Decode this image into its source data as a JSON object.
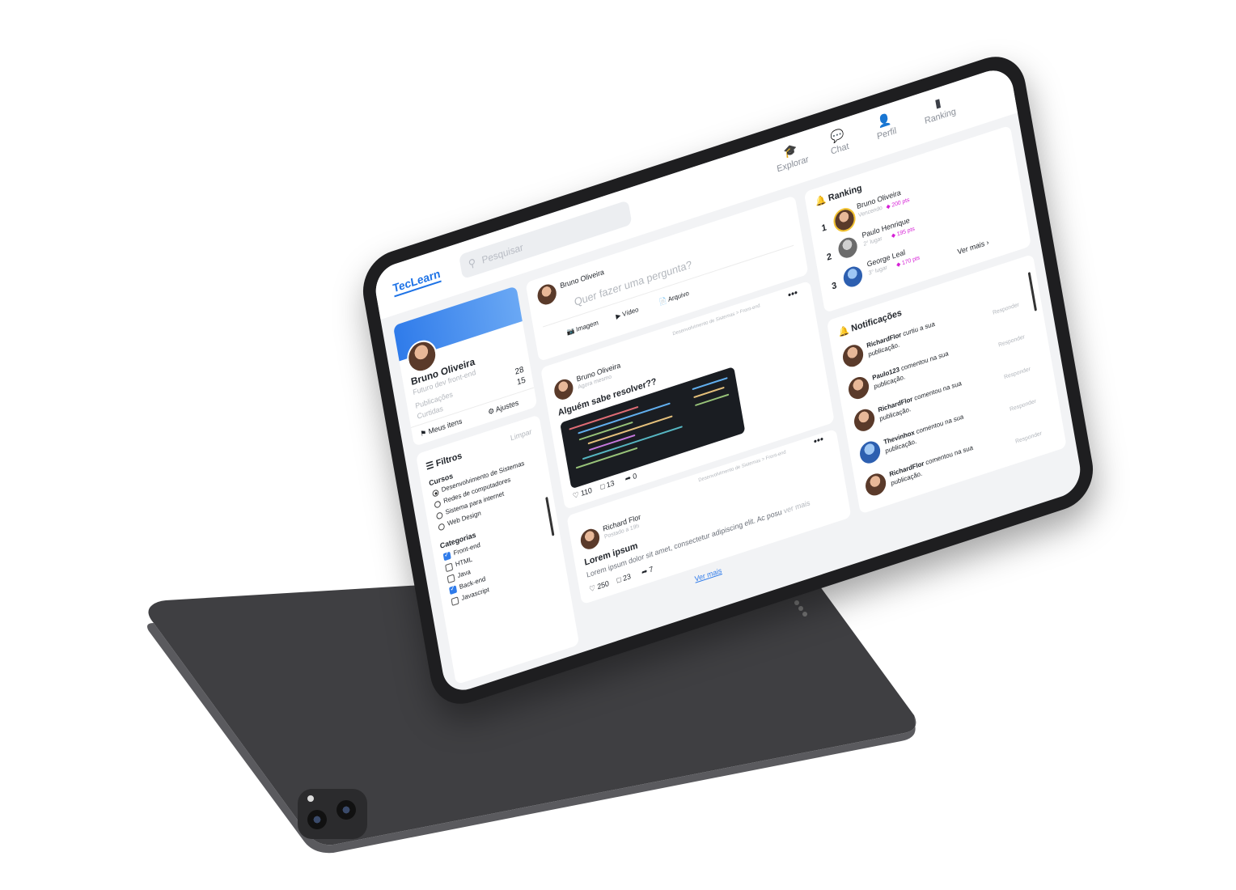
{
  "topbar": {
    "logo": "TecLearn",
    "search_placeholder": "Pesquisar",
    "nav": [
      {
        "label": "Explorar",
        "icon": "graduation-cap-icon"
      },
      {
        "label": "Chat",
        "icon": "chat-icon"
      },
      {
        "label": "Perfil",
        "icon": "user-icon"
      },
      {
        "label": "Ranking",
        "icon": "bar-chart-icon"
      }
    ]
  },
  "profile": {
    "name": "Bruno Oliveira",
    "subtitle": "Futuro dev front-end",
    "stats": [
      {
        "label": "Publicações",
        "value": "28"
      },
      {
        "label": "Curtidas",
        "value": "15"
      }
    ],
    "my_items": "Meus itens",
    "settings": "Ajustes"
  },
  "filters": {
    "title": "Filtros",
    "clear": "Limpar",
    "courses_title": "Cursos",
    "courses": [
      {
        "label": "Desenvolvimento de Sistemas",
        "selected": true
      },
      {
        "label": "Redes de computadores",
        "selected": false
      },
      {
        "label": "Sistema para internet",
        "selected": false
      },
      {
        "label": "Web Design",
        "selected": false
      }
    ],
    "categories_title": "Categorias",
    "categories": [
      {
        "label": "Front-end",
        "checked": true
      },
      {
        "label": "HTML",
        "checked": false
      },
      {
        "label": "Java",
        "checked": false
      },
      {
        "label": "Back-end",
        "checked": true
      },
      {
        "label": "Javascript",
        "checked": false
      }
    ]
  },
  "composer": {
    "user": "Bruno Oliveira",
    "placeholder": "Quer fazer uma pergunta?",
    "actions": [
      "Imagem",
      "Vídeo",
      "Arquivo"
    ]
  },
  "posts": [
    {
      "tag": "Desenvolvimento de Sistemas > Front-end",
      "author": "Bruno Oliveira",
      "time": "Agora mesmo",
      "title": "Alguém sabe resolver??",
      "likes": "110",
      "comments": "13",
      "shares": "0"
    },
    {
      "tag": "Desenvolvimento de Sistemas > Front-end",
      "author": "Richard Flor",
      "time": "Postado a 19h",
      "title": "Lorem ipsum",
      "body": "Lorem ipsum dolor sit amet, consectetur adipiscing elit. Ac posu",
      "see_more": "ver mais",
      "likes": "250",
      "comments": "23",
      "shares": "7"
    }
  ],
  "feed_more": "Ver mais",
  "ranking": {
    "title": "Ranking",
    "entries": [
      {
        "pos": "1",
        "name": "Bruno Oliveira",
        "status": "Vencendo",
        "pts": "200 pts"
      },
      {
        "pos": "2",
        "name": "Paulo Henrique",
        "status": "2° lugar",
        "pts": "195 pts"
      },
      {
        "pos": "3",
        "name": "George Leal",
        "status": "3° lugar",
        "pts": "170 pts"
      }
    ],
    "see_more": "Ver mais"
  },
  "notifications": {
    "title": "Notificações",
    "reply_label": "Responder",
    "items": [
      {
        "user": "RichardFlor",
        "action": "curtiu a sua",
        "rest": "publicação."
      },
      {
        "user": "Paulo123",
        "action": "comentou na sua",
        "rest": "publicação."
      },
      {
        "user": "RichardFlor",
        "action": "comentou na sua",
        "rest": "publicação."
      },
      {
        "user": "Thevinhox",
        "action": "comentou na sua",
        "rest": "publicação."
      },
      {
        "user": "RichardFlor",
        "action": "comentou na sua",
        "rest": "publicação."
      }
    ]
  },
  "colors": {
    "accent": "#1e73e6",
    "points": "#d61fd6",
    "frame": "#1e1e20",
    "back_tablet": "#3f3f42"
  }
}
